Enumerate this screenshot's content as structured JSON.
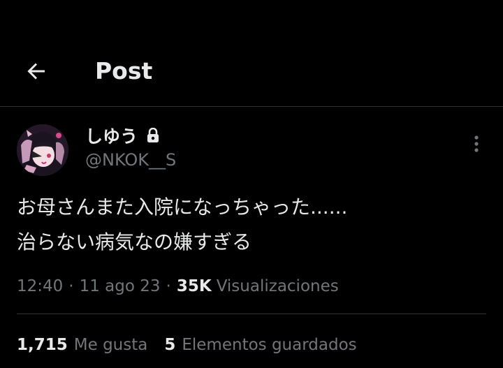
{
  "header": {
    "back_icon": "arrow-left-icon",
    "title": "Post"
  },
  "author": {
    "display_name": "しゆう",
    "handle": "@NKOK__S",
    "protected_icon": "lock-icon",
    "avatar_icon": "anime-character-avatar"
  },
  "tweet": {
    "lines": [
      "お母さんまた入院になっちゃった......",
      "治らない病気なの嫌すぎる"
    ],
    "time": "12:40",
    "date": "11 ago 23",
    "separator": "·",
    "views_count": "35K",
    "views_label": "Visualizaciones"
  },
  "stats": {
    "likes_count": "1,715",
    "likes_label": "Me gusta",
    "bookmarks_count": "5",
    "bookmarks_label": "Elementos guardados"
  },
  "more_icon": "more-vertical-icon",
  "colors": {
    "background": "#000000",
    "text_primary": "#e7e9ea",
    "text_secondary": "#71767b",
    "border": "#2f3336"
  }
}
